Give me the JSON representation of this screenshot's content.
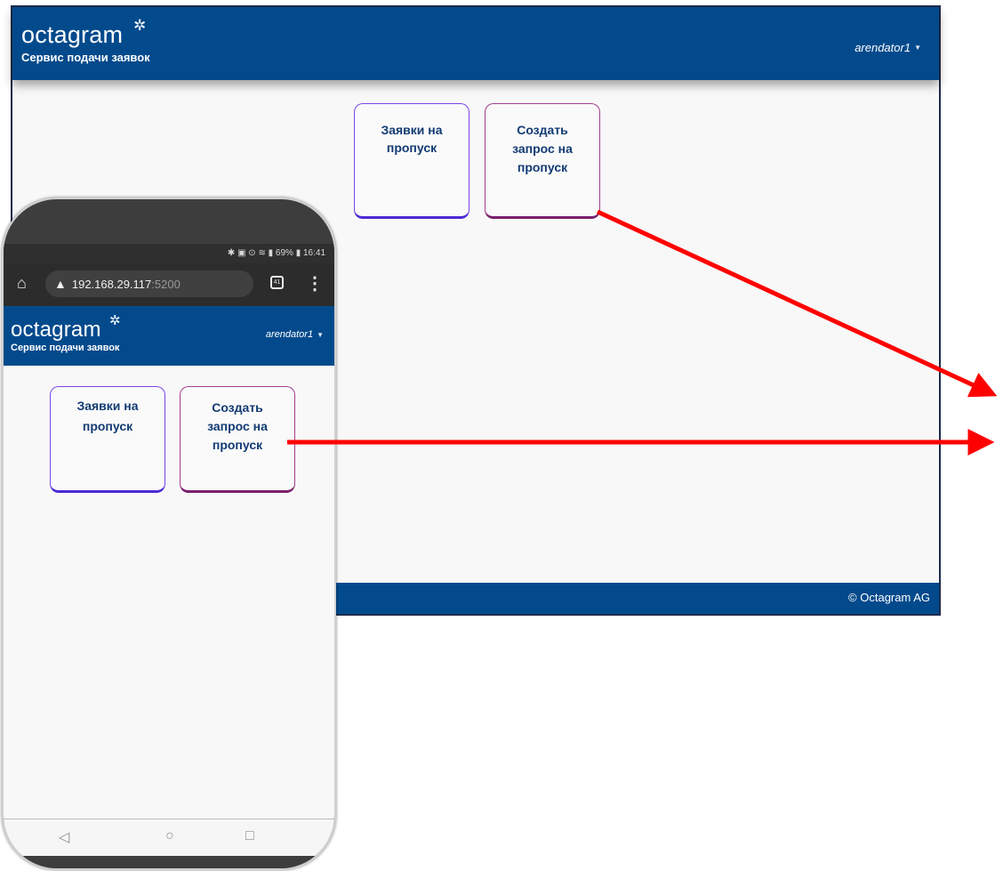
{
  "desktop": {
    "logo_name": "octagram",
    "logo_star": "✲",
    "logo_subtitle": "Сервис подачи заявок",
    "user": "arendator1",
    "caret": "▼",
    "tiles": [
      {
        "label": "Заявки на\nпропуск"
      },
      {
        "label": "Создать\nзапрос на\nпропуск"
      }
    ],
    "footer": "© Octagram AG"
  },
  "phone": {
    "status": "✱ ▣ ⊙ ≋ ▮ 69% ▮ 16:41",
    "url_host": "192.168.29.117",
    "url_port": ":5200",
    "tabs_count": "41",
    "more": "⋮",
    "home_glyph": "⌂",
    "warn_glyph": "▲",
    "logo_name": "octagram",
    "logo_star": "✲",
    "logo_subtitle": "Сервис подачи заявок",
    "user": "arendator1",
    "caret": "▼",
    "tiles": [
      {
        "label": "Заявки на\nпропуск"
      },
      {
        "label": "Создать\nзапрос на\nпропуск"
      }
    ],
    "nav": {
      "back": "◁",
      "home": "○",
      "recent": "□"
    }
  },
  "colors": {
    "brand": "#034a8c",
    "arrow": "#ff0000",
    "tile_blue": "#4b2ad6",
    "tile_purple": "#7a1f6c"
  }
}
